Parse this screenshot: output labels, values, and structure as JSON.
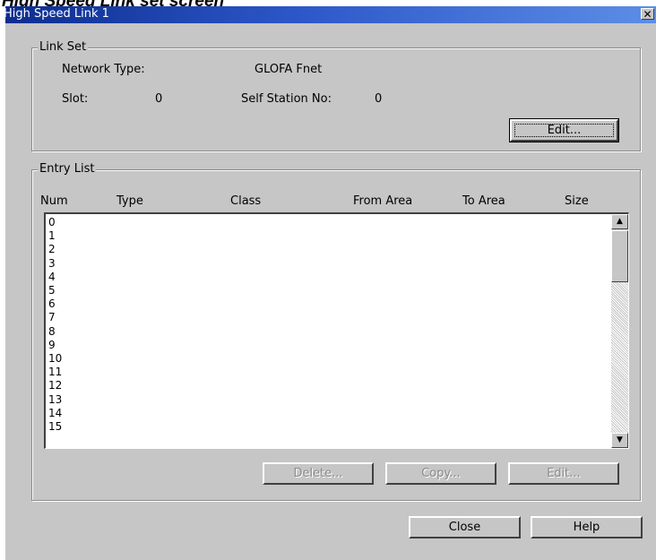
{
  "caption": "High Speed Link set screen",
  "window": {
    "title": "High Speed Link 1",
    "close_glyph": "✕"
  },
  "link_set": {
    "group_label": "Link Set",
    "network_type_label": "Network Type:",
    "network_type_value": "GLOFA Fnet",
    "slot_label": "Slot:",
    "slot_value": "0",
    "self_station_label": "Self Station No:",
    "self_station_value": "0",
    "edit_label": "Edit..."
  },
  "entry_list": {
    "group_label": "Entry List",
    "columns": [
      "Num",
      "Type",
      "Class",
      "From Area",
      "To Area",
      "Size"
    ],
    "rows": [
      "0",
      "1",
      "2",
      "3",
      "4",
      "5",
      "6",
      "7",
      "8",
      "9",
      "10",
      "11",
      "12",
      "13",
      "14",
      "15"
    ],
    "scroll_up_icon": "scroll-up-arrow",
    "scroll_down_icon": "scroll-down-arrow",
    "delete_label": "Delete...",
    "copy_label": "Copy...",
    "edit_label": "Edit..."
  },
  "footer": {
    "close_label": "Close",
    "help_label": "Help"
  }
}
